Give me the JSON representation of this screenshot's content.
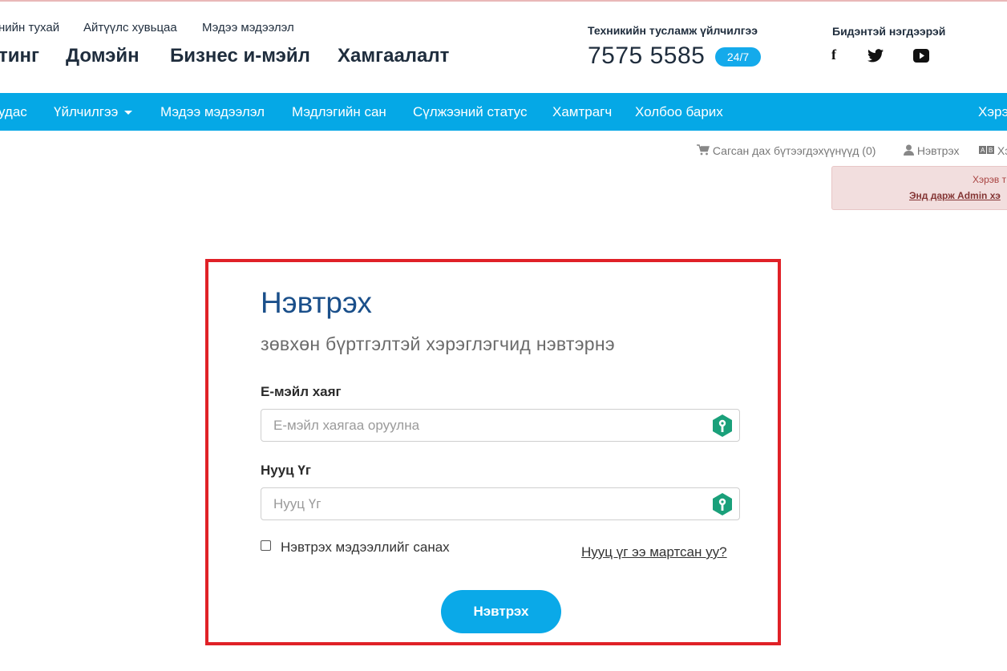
{
  "header": {
    "top_links": [
      "нийн тухай",
      "Айтүүлс хувьцаа",
      "Мэдээ мэдээлэл"
    ],
    "main_links": [
      "тинг",
      "Домэйн",
      "Бизнес и-мэйл",
      "Хамгаалалт"
    ],
    "support_label": "Техникийн тусламж үйлчилгээ",
    "support_phone": "7575 5585",
    "support_badge": "24/7",
    "social_label": "Бидэнтэй нэгдээрэй",
    "social_icons": [
      "facebook-icon",
      "twitter-icon",
      "youtube-icon"
    ]
  },
  "menu": {
    "items": [
      "удас",
      "Үйлчилгээ",
      "Мэдээ мэдээлэл",
      "Мэдлэгийн сан",
      "Сүлжээний статус",
      "Хамтрагч",
      "Холбоо барих"
    ],
    "right_item": "Хэрэ"
  },
  "subrow": {
    "cart": "Сагсан дах бүтээгдэхүүнүүд (0)",
    "login": "Нэвтрэх",
    "lang": "Хэ"
  },
  "alert": {
    "line1": "Хэрэв т",
    "line2": "Энд дарж Admin хэ"
  },
  "login": {
    "title": "Нэвтрэх",
    "subtitle": "зөвхөн бүртгэлтэй хэрэглэгчид нэвтэрнэ",
    "email_label": "Е-мэйл хаяг",
    "email_placeholder": "Е-мэйл хаягаа оруулна",
    "password_label": "Нууц Үг",
    "password_placeholder": "Нууц Үг",
    "remember_label": "Нэвтрэх мэдээллийг санах",
    "forgot_link": "Нууц үг ээ мартсан уу?",
    "submit_label": "Нэвтрэх"
  },
  "colors": {
    "menu_bg": "#05a8e6",
    "title": "#1a4f8a",
    "button": "#0aa9e8",
    "key_icon": "#1aa07a",
    "highlight_frame": "#e02127"
  }
}
